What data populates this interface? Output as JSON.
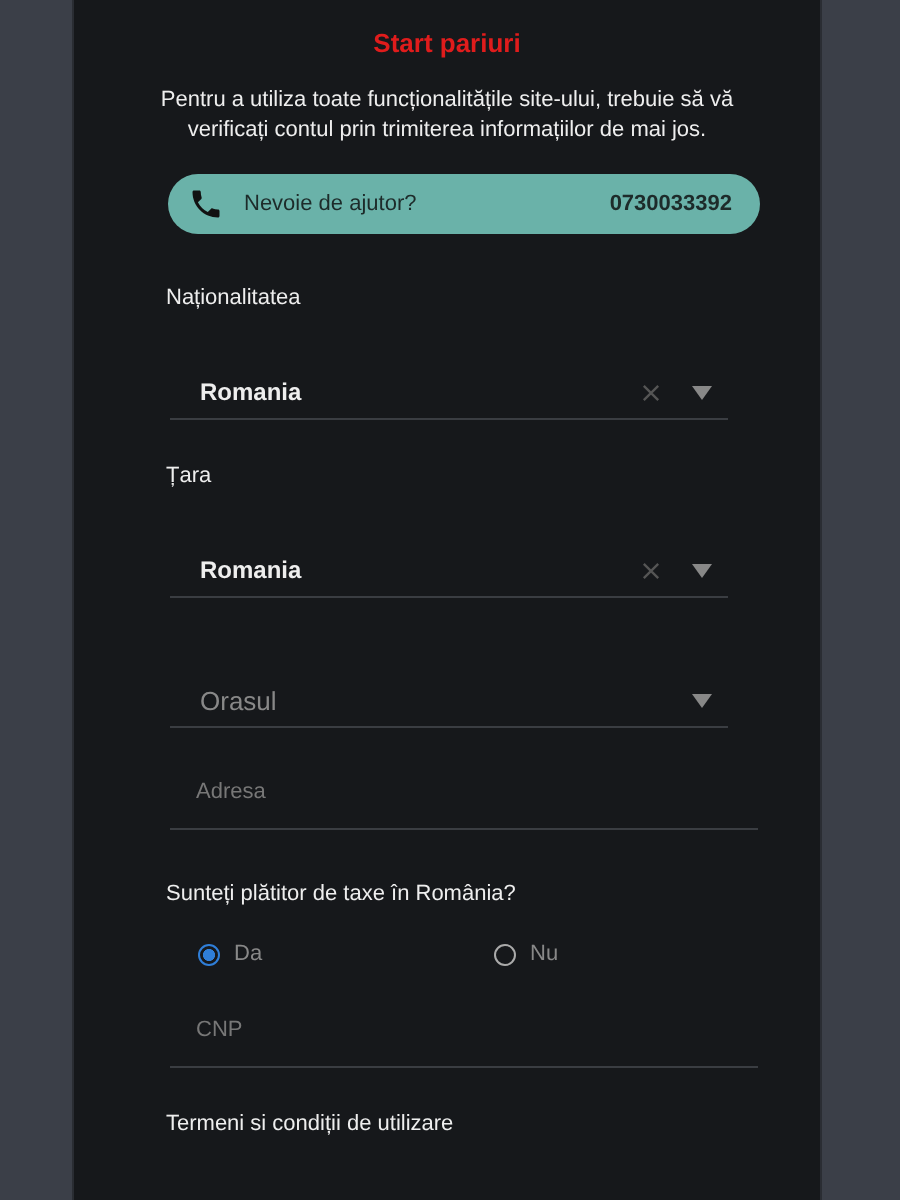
{
  "title": "Start pariuri",
  "intro": "Pentru a utiliza toate funcționalitățile site-ului, trebuie să vă verificați contul prin trimiterea informațiilor de mai jos.",
  "help": {
    "label": "Nevoie de ajutor?",
    "phone": "0730033392"
  },
  "fields": [
    {
      "kind": "select",
      "label": "Naționalitatea",
      "value": "Romania"
    },
    {
      "kind": "select",
      "label": "Țara",
      "value": "Romania"
    },
    {
      "kind": "select",
      "placeholder": "Orasul"
    },
    {
      "kind": "input",
      "placeholder": "Adresa"
    },
    {
      "kind": "radio",
      "label": "Sunteți plătitor de taxe în România?",
      "options": [
        {
          "label": "Da",
          "selected": true
        },
        {
          "label": "Nu",
          "selected": false
        }
      ]
    },
    {
      "kind": "input",
      "placeholder": "CNP"
    }
  ],
  "terms": "Termeni si condiții de utilizare"
}
